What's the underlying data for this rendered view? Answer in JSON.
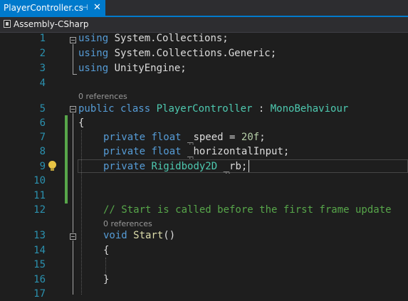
{
  "tab": {
    "title": "PlayerController.cs",
    "pin_glyph": "⊣",
    "close_glyph": "✕"
  },
  "navbar": {
    "project": "Assembly-CSharp"
  },
  "editor": {
    "line_numbers": [
      "1",
      "2",
      "3",
      "4",
      "5",
      "6",
      "7",
      "8",
      "9",
      "10",
      "11",
      "12",
      "13",
      "14",
      "15",
      "16",
      "17"
    ],
    "codelens_class": "0 references",
    "codelens_method": "0 references",
    "lines": {
      "l1": {
        "kw": "using",
        "rest": " System.Collections;"
      },
      "l2": {
        "kw": "using",
        "rest": " System.Collections.Generic;"
      },
      "l3": {
        "kw": "using",
        "rest": " UnityEngine;"
      },
      "l5": {
        "kw1": "public",
        "kw2": " class",
        "name": " PlayerController",
        "colon": " :",
        "base": " MonoBehaviour"
      },
      "l6": "{",
      "l7": {
        "kw1": "private",
        "kw2": " float",
        "name": " _speed",
        "eq": " = ",
        "num": "20f",
        "end": ";"
      },
      "l8": {
        "kw1": "private",
        "kw2": " float",
        "name": " _horizontalInput",
        "end": ";"
      },
      "l9": {
        "kw1": "private",
        "type": " Rigidbody2D",
        "name": " _rb",
        "end": ";"
      },
      "l12": "// Start is called before the first frame update",
      "l13": {
        "kw": "void",
        "name": " Start",
        "parens": "()"
      },
      "l14": "{",
      "l16": "}"
    }
  }
}
